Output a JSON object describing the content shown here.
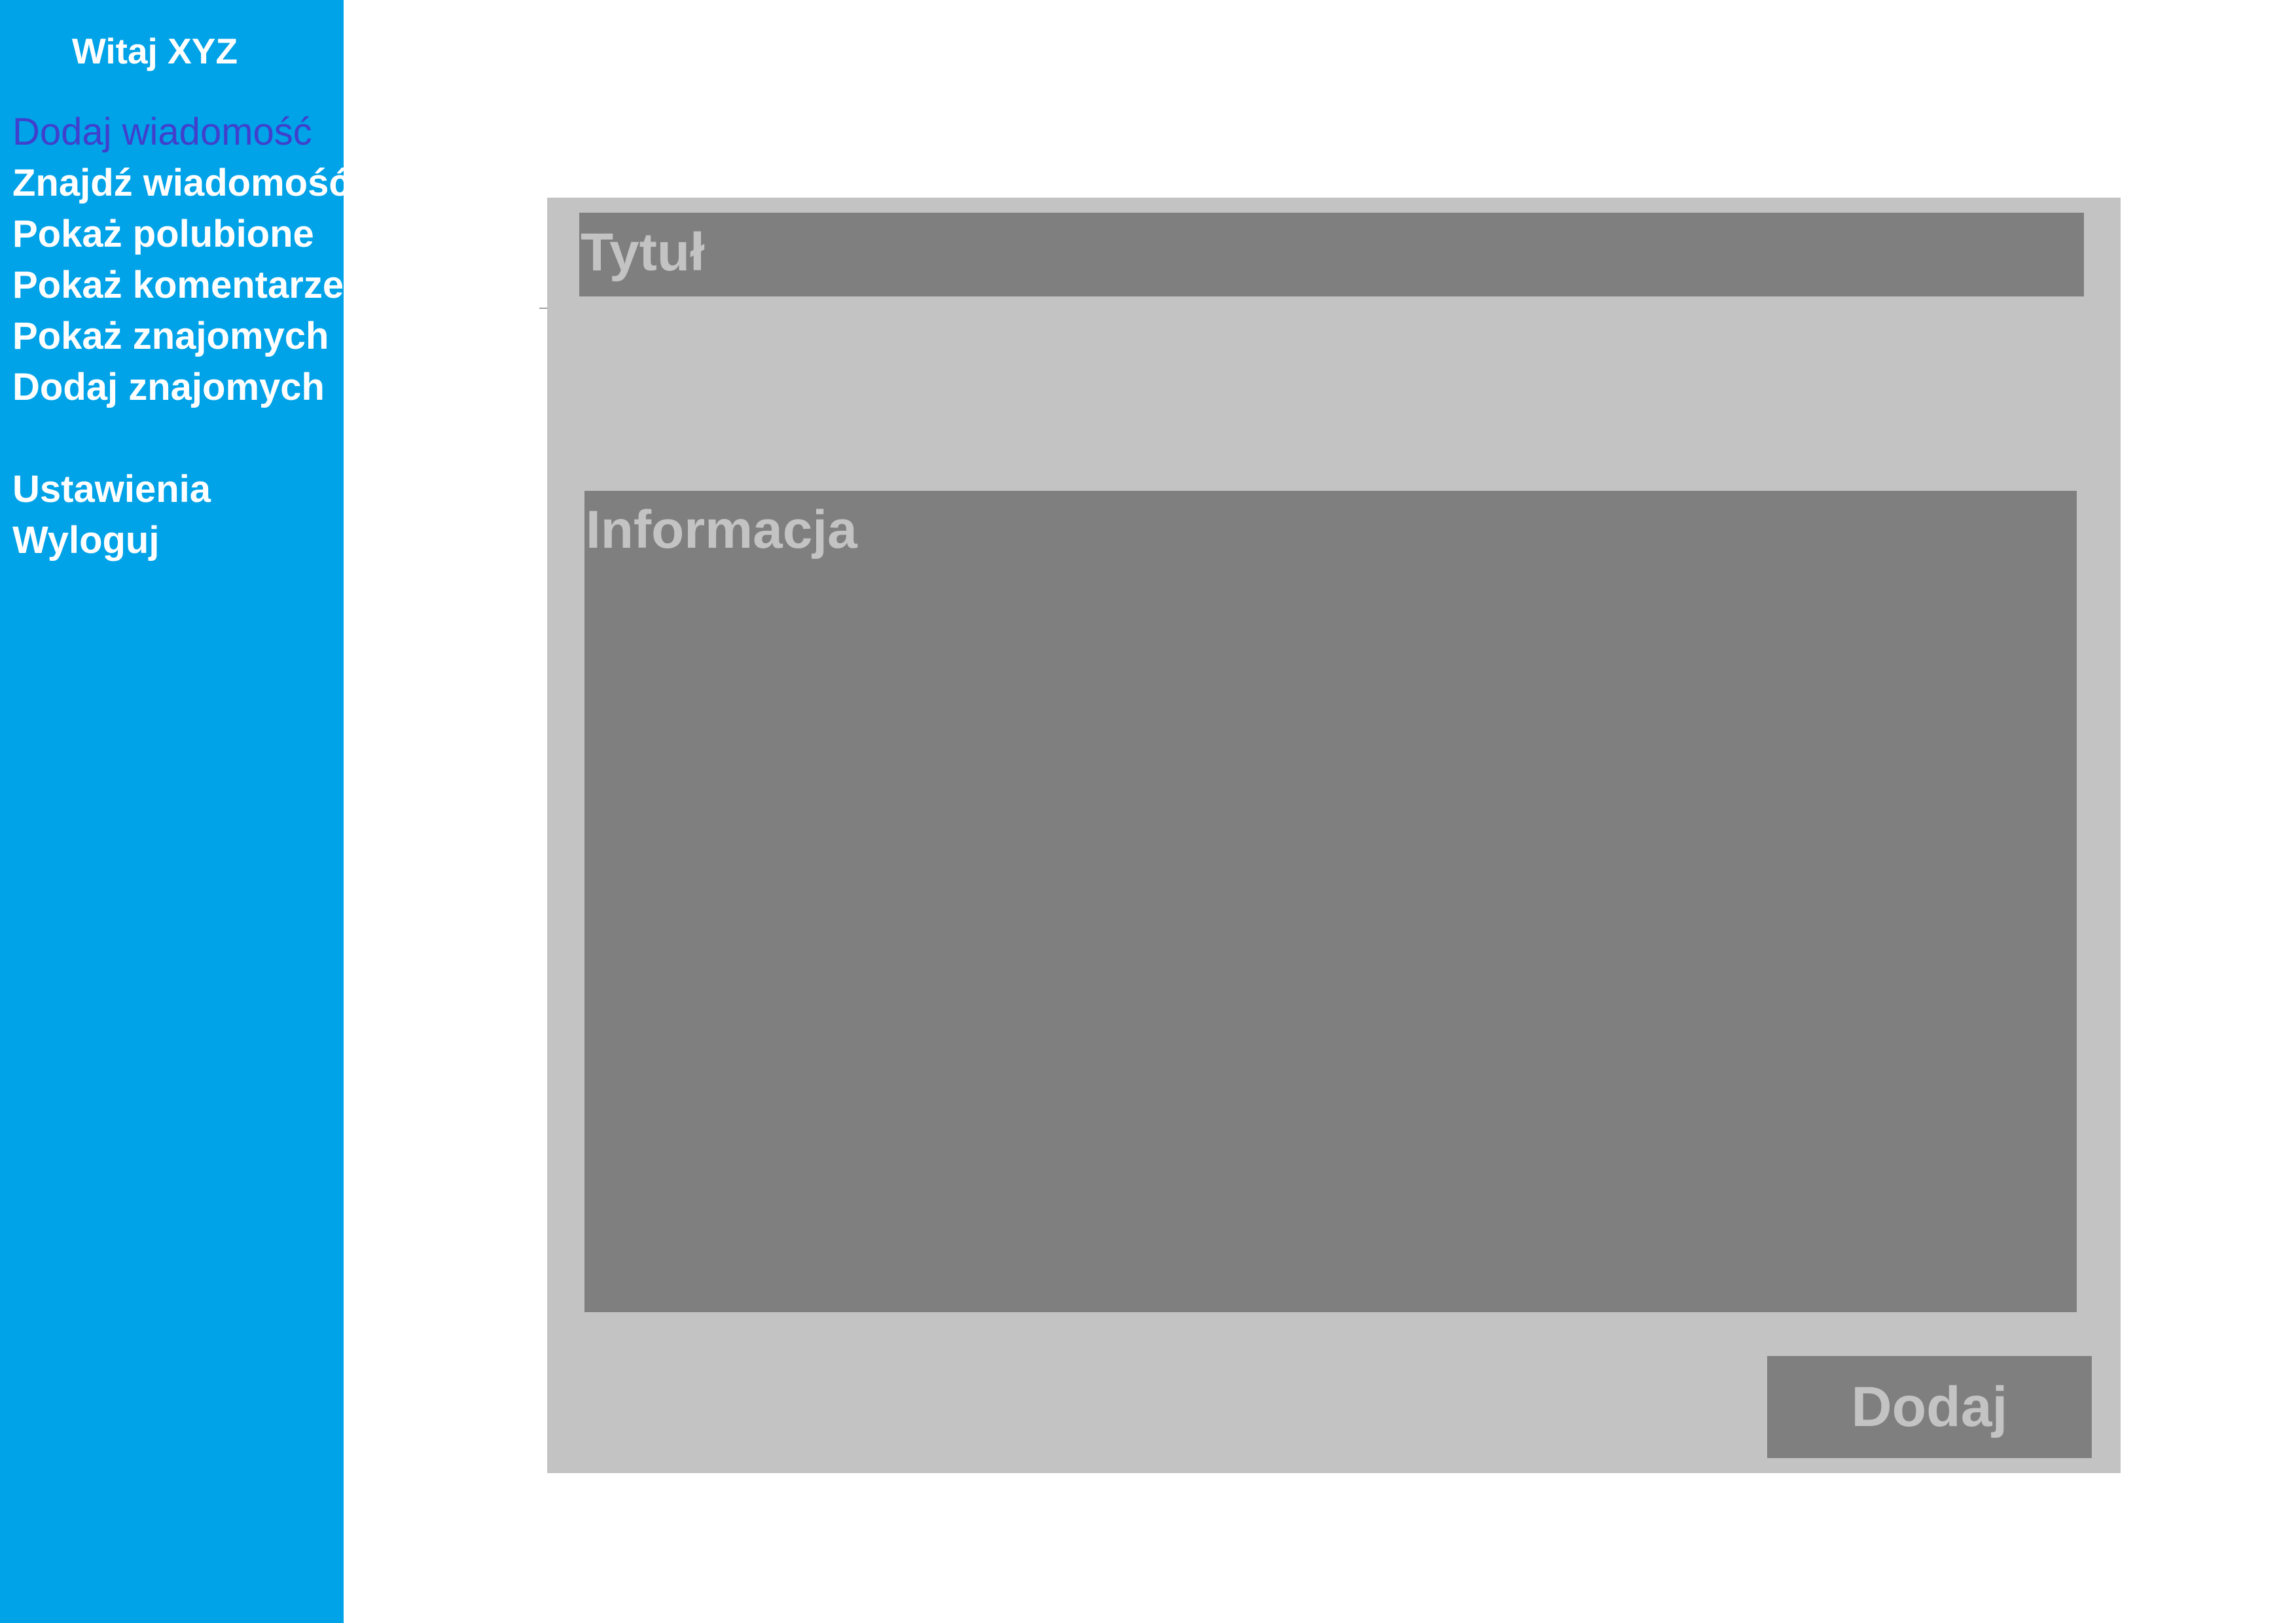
{
  "sidebar": {
    "welcome": "Witaj XYZ",
    "items": [
      {
        "label": "Dodaj wiadomość"
      },
      {
        "label": "Znajdź wiadomość"
      },
      {
        "label": "Pokaż polubione"
      },
      {
        "label": "Pokaż komentarze"
      },
      {
        "label": "Pokaż znajomych"
      },
      {
        "label": "Dodaj znajomych"
      }
    ],
    "secondary_items": [
      {
        "label": "Ustawienia"
      },
      {
        "label": "Wyloguj"
      }
    ]
  },
  "form": {
    "title_placeholder": "Tytuł",
    "info_placeholder": "Informacja",
    "submit_label": "Dodaj"
  },
  "colors": {
    "sidebar_bg": "#00a2e8",
    "active_item": "#4040cc",
    "panel_bg": "#c3c3c3",
    "field_bg": "#7f7f7f"
  }
}
